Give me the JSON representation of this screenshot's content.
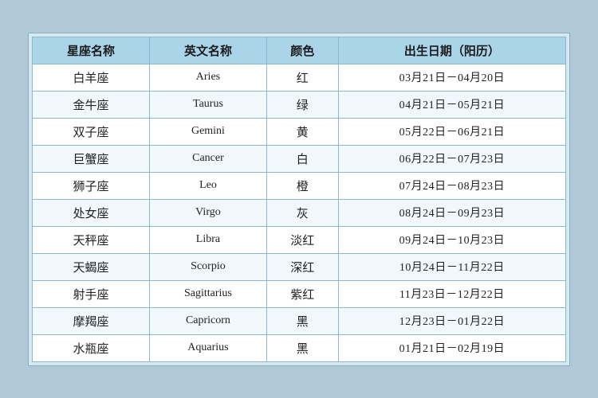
{
  "table": {
    "headers": [
      "星座名称",
      "英文名称",
      "颜色",
      "出生日期（阳历）"
    ],
    "rows": [
      [
        "白羊座",
        "Aries",
        "红",
        "03月21日－04月20日"
      ],
      [
        "金牛座",
        "Taurus",
        "绿",
        "04月21日－05月21日"
      ],
      [
        "双子座",
        "Gemini",
        "黄",
        "05月22日－06月21日"
      ],
      [
        "巨蟹座",
        "Cancer",
        "白",
        "06月22日－07月23日"
      ],
      [
        "狮子座",
        "Leo",
        "橙",
        "07月24日－08月23日"
      ],
      [
        "处女座",
        "Virgo",
        "灰",
        "08月24日－09月23日"
      ],
      [
        "天秤座",
        "Libra",
        "淡红",
        "09月24日－10月23日"
      ],
      [
        "天蝎座",
        "Scorpio",
        "深红",
        "10月24日－11月22日"
      ],
      [
        "射手座",
        "Sagittarius",
        "紫红",
        "11月23日－12月22日"
      ],
      [
        "摩羯座",
        "Capricorn",
        "黑",
        "12月23日－01月22日"
      ],
      [
        "水瓶座",
        "Aquarius",
        "黑",
        "01月21日－02月19日"
      ]
    ]
  }
}
